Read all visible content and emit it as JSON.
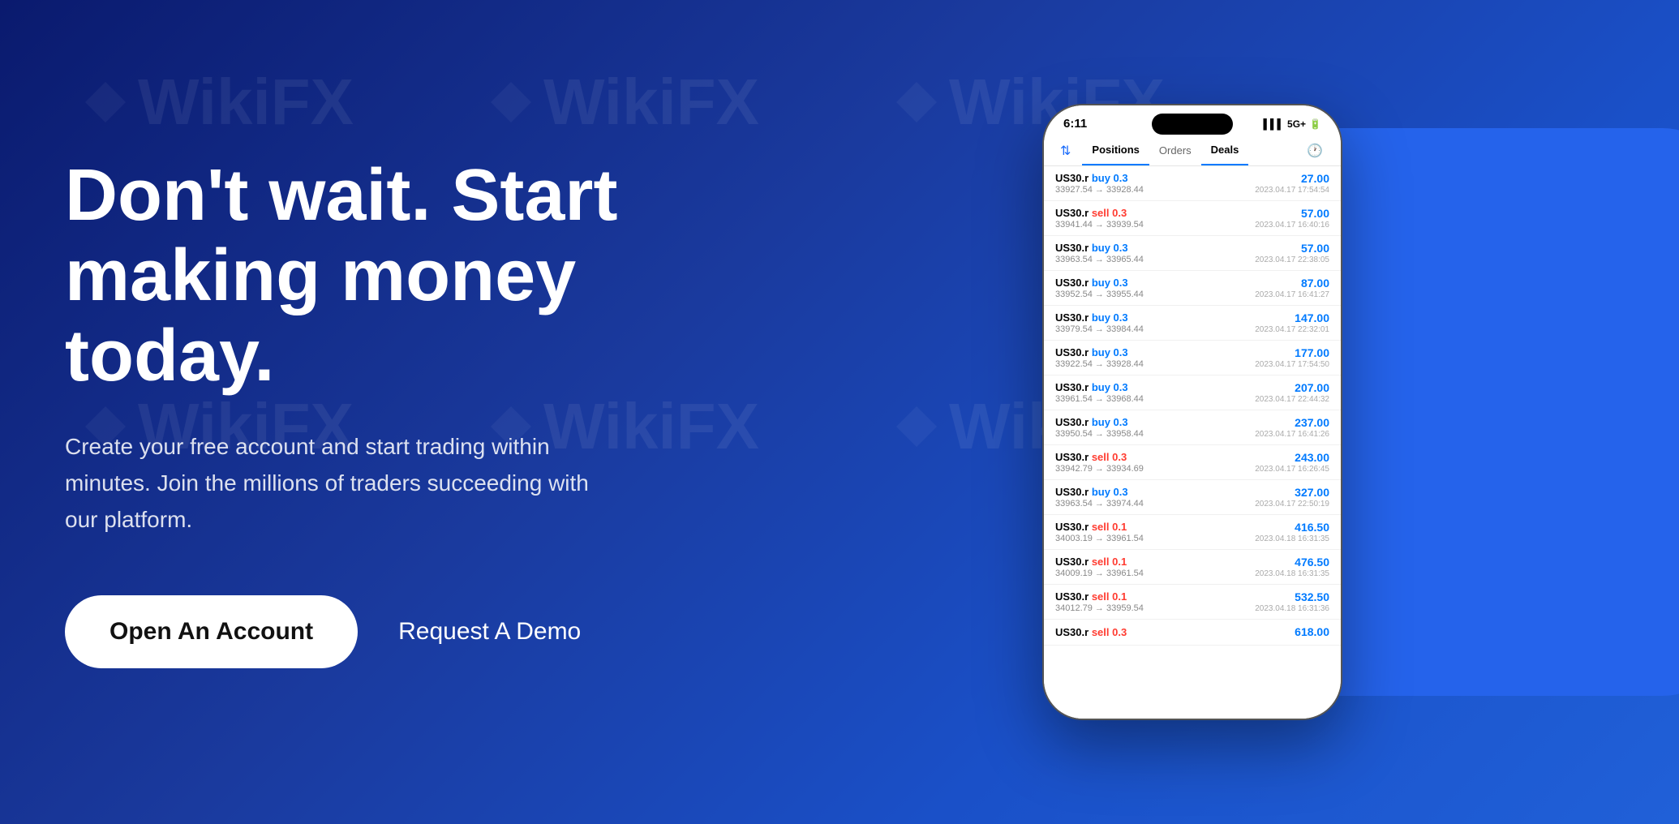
{
  "hero": {
    "headline": "Don't wait. Start making money today.",
    "subtext": "Create your free account and start trading within minutes. Join the millions of traders succeeding with our platform.",
    "cta_open": "Open An Account",
    "cta_demo": "Request A Demo"
  },
  "phone": {
    "status_time": "6:11",
    "status_signal": "5G+",
    "tabs": [
      "Positions",
      "Orders",
      "Deals"
    ],
    "active_tab": "Deals",
    "trades": [
      {
        "symbol": "US30.r",
        "action": "buy",
        "qty": "0.3",
        "from": "33927.54",
        "to": "33928.44",
        "pnl": "27.00",
        "time": "2023.04.17 17:54:54"
      },
      {
        "symbol": "US30.r",
        "action": "sell",
        "qty": "0.3",
        "from": "33941.44",
        "to": "33939.54",
        "pnl": "57.00",
        "time": "2023.04.17 16:40:16"
      },
      {
        "symbol": "US30.r",
        "action": "buy",
        "qty": "0.3",
        "from": "33963.54",
        "to": "33965.44",
        "pnl": "57.00",
        "time": "2023.04.17 22:38:05"
      },
      {
        "symbol": "US30.r",
        "action": "buy",
        "qty": "0.3",
        "from": "33952.54",
        "to": "33955.44",
        "pnl": "87.00",
        "time": "2023.04.17 16:41:27"
      },
      {
        "symbol": "US30.r",
        "action": "buy",
        "qty": "0.3",
        "from": "33979.54",
        "to": "33984.44",
        "pnl": "147.00",
        "time": "2023.04.17 22:32:01"
      },
      {
        "symbol": "US30.r",
        "action": "buy",
        "qty": "0.3",
        "from": "33922.54",
        "to": "33928.44",
        "pnl": "177.00",
        "time": "2023.04.17 17:54:50"
      },
      {
        "symbol": "US30.r",
        "action": "buy",
        "qty": "0.3",
        "from": "33961.54",
        "to": "33968.44",
        "pnl": "207.00",
        "time": "2023.04.17 22:44:32"
      },
      {
        "symbol": "US30.r",
        "action": "buy",
        "qty": "0.3",
        "from": "33950.54",
        "to": "33958.44",
        "pnl": "237.00",
        "time": "2023.04.17 16:41:26"
      },
      {
        "symbol": "US30.r",
        "action": "sell",
        "qty": "0.3",
        "from": "33942.79",
        "to": "33934.69",
        "pnl": "243.00",
        "time": "2023.04.17 16:26:45"
      },
      {
        "symbol": "US30.r",
        "action": "buy",
        "qty": "0.3",
        "from": "33963.54",
        "to": "33974.44",
        "pnl": "327.00",
        "time": "2023.04.17 22:50:19"
      },
      {
        "symbol": "US30.r",
        "action": "sell",
        "qty": "0.1",
        "from": "34003.19",
        "to": "33961.54",
        "pnl": "416.50",
        "time": "2023.04.18 16:31:35"
      },
      {
        "symbol": "US30.r",
        "action": "sell",
        "qty": "0.1",
        "from": "34009.19",
        "to": "33961.54",
        "pnl": "476.50",
        "time": "2023.04.18 16:31:35"
      },
      {
        "symbol": "US30.r",
        "action": "sell",
        "qty": "0.1",
        "from": "34012.79",
        "to": "33959.54",
        "pnl": "532.50",
        "time": "2023.04.18 16:31:36"
      },
      {
        "symbol": "US30.r",
        "action": "sell",
        "qty": "0.3",
        "from": "",
        "to": "",
        "pnl": "618.00",
        "time": ""
      }
    ]
  },
  "watermark_text": "WikiFX"
}
